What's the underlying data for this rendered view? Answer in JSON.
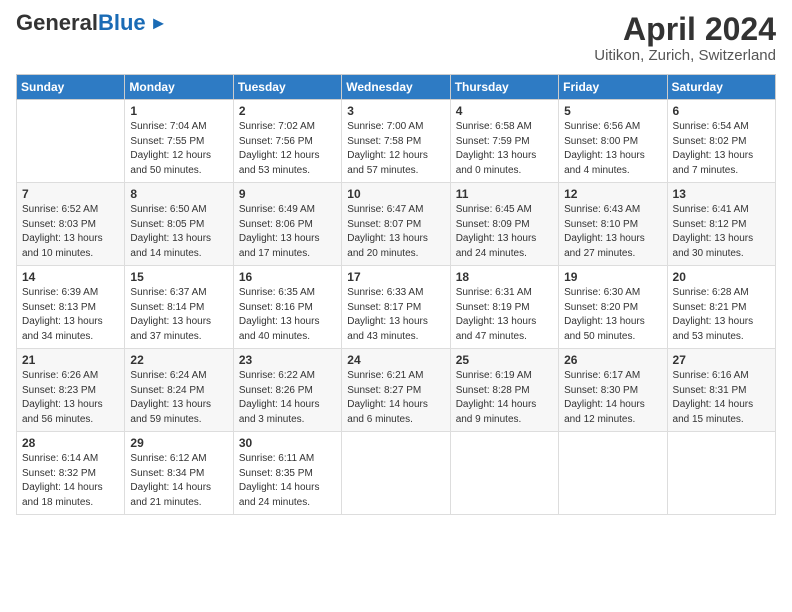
{
  "header": {
    "logo_general": "General",
    "logo_blue": "Blue",
    "month_title": "April 2024",
    "location": "Uitikon, Zurich, Switzerland"
  },
  "days_of_week": [
    "Sunday",
    "Monday",
    "Tuesday",
    "Wednesday",
    "Thursday",
    "Friday",
    "Saturday"
  ],
  "weeks": [
    [
      {
        "num": "",
        "info": ""
      },
      {
        "num": "1",
        "info": "Sunrise: 7:04 AM\nSunset: 7:55 PM\nDaylight: 12 hours\nand 50 minutes."
      },
      {
        "num": "2",
        "info": "Sunrise: 7:02 AM\nSunset: 7:56 PM\nDaylight: 12 hours\nand 53 minutes."
      },
      {
        "num": "3",
        "info": "Sunrise: 7:00 AM\nSunset: 7:58 PM\nDaylight: 12 hours\nand 57 minutes."
      },
      {
        "num": "4",
        "info": "Sunrise: 6:58 AM\nSunset: 7:59 PM\nDaylight: 13 hours\nand 0 minutes."
      },
      {
        "num": "5",
        "info": "Sunrise: 6:56 AM\nSunset: 8:00 PM\nDaylight: 13 hours\nand 4 minutes."
      },
      {
        "num": "6",
        "info": "Sunrise: 6:54 AM\nSunset: 8:02 PM\nDaylight: 13 hours\nand 7 minutes."
      }
    ],
    [
      {
        "num": "7",
        "info": "Sunrise: 6:52 AM\nSunset: 8:03 PM\nDaylight: 13 hours\nand 10 minutes."
      },
      {
        "num": "8",
        "info": "Sunrise: 6:50 AM\nSunset: 8:05 PM\nDaylight: 13 hours\nand 14 minutes."
      },
      {
        "num": "9",
        "info": "Sunrise: 6:49 AM\nSunset: 8:06 PM\nDaylight: 13 hours\nand 17 minutes."
      },
      {
        "num": "10",
        "info": "Sunrise: 6:47 AM\nSunset: 8:07 PM\nDaylight: 13 hours\nand 20 minutes."
      },
      {
        "num": "11",
        "info": "Sunrise: 6:45 AM\nSunset: 8:09 PM\nDaylight: 13 hours\nand 24 minutes."
      },
      {
        "num": "12",
        "info": "Sunrise: 6:43 AM\nSunset: 8:10 PM\nDaylight: 13 hours\nand 27 minutes."
      },
      {
        "num": "13",
        "info": "Sunrise: 6:41 AM\nSunset: 8:12 PM\nDaylight: 13 hours\nand 30 minutes."
      }
    ],
    [
      {
        "num": "14",
        "info": "Sunrise: 6:39 AM\nSunset: 8:13 PM\nDaylight: 13 hours\nand 34 minutes."
      },
      {
        "num": "15",
        "info": "Sunrise: 6:37 AM\nSunset: 8:14 PM\nDaylight: 13 hours\nand 37 minutes."
      },
      {
        "num": "16",
        "info": "Sunrise: 6:35 AM\nSunset: 8:16 PM\nDaylight: 13 hours\nand 40 minutes."
      },
      {
        "num": "17",
        "info": "Sunrise: 6:33 AM\nSunset: 8:17 PM\nDaylight: 13 hours\nand 43 minutes."
      },
      {
        "num": "18",
        "info": "Sunrise: 6:31 AM\nSunset: 8:19 PM\nDaylight: 13 hours\nand 47 minutes."
      },
      {
        "num": "19",
        "info": "Sunrise: 6:30 AM\nSunset: 8:20 PM\nDaylight: 13 hours\nand 50 minutes."
      },
      {
        "num": "20",
        "info": "Sunrise: 6:28 AM\nSunset: 8:21 PM\nDaylight: 13 hours\nand 53 minutes."
      }
    ],
    [
      {
        "num": "21",
        "info": "Sunrise: 6:26 AM\nSunset: 8:23 PM\nDaylight: 13 hours\nand 56 minutes."
      },
      {
        "num": "22",
        "info": "Sunrise: 6:24 AM\nSunset: 8:24 PM\nDaylight: 13 hours\nand 59 minutes."
      },
      {
        "num": "23",
        "info": "Sunrise: 6:22 AM\nSunset: 8:26 PM\nDaylight: 14 hours\nand 3 minutes."
      },
      {
        "num": "24",
        "info": "Sunrise: 6:21 AM\nSunset: 8:27 PM\nDaylight: 14 hours\nand 6 minutes."
      },
      {
        "num": "25",
        "info": "Sunrise: 6:19 AM\nSunset: 8:28 PM\nDaylight: 14 hours\nand 9 minutes."
      },
      {
        "num": "26",
        "info": "Sunrise: 6:17 AM\nSunset: 8:30 PM\nDaylight: 14 hours\nand 12 minutes."
      },
      {
        "num": "27",
        "info": "Sunrise: 6:16 AM\nSunset: 8:31 PM\nDaylight: 14 hours\nand 15 minutes."
      }
    ],
    [
      {
        "num": "28",
        "info": "Sunrise: 6:14 AM\nSunset: 8:32 PM\nDaylight: 14 hours\nand 18 minutes."
      },
      {
        "num": "29",
        "info": "Sunrise: 6:12 AM\nSunset: 8:34 PM\nDaylight: 14 hours\nand 21 minutes."
      },
      {
        "num": "30",
        "info": "Sunrise: 6:11 AM\nSunset: 8:35 PM\nDaylight: 14 hours\nand 24 minutes."
      },
      {
        "num": "",
        "info": ""
      },
      {
        "num": "",
        "info": ""
      },
      {
        "num": "",
        "info": ""
      },
      {
        "num": "",
        "info": ""
      }
    ]
  ]
}
